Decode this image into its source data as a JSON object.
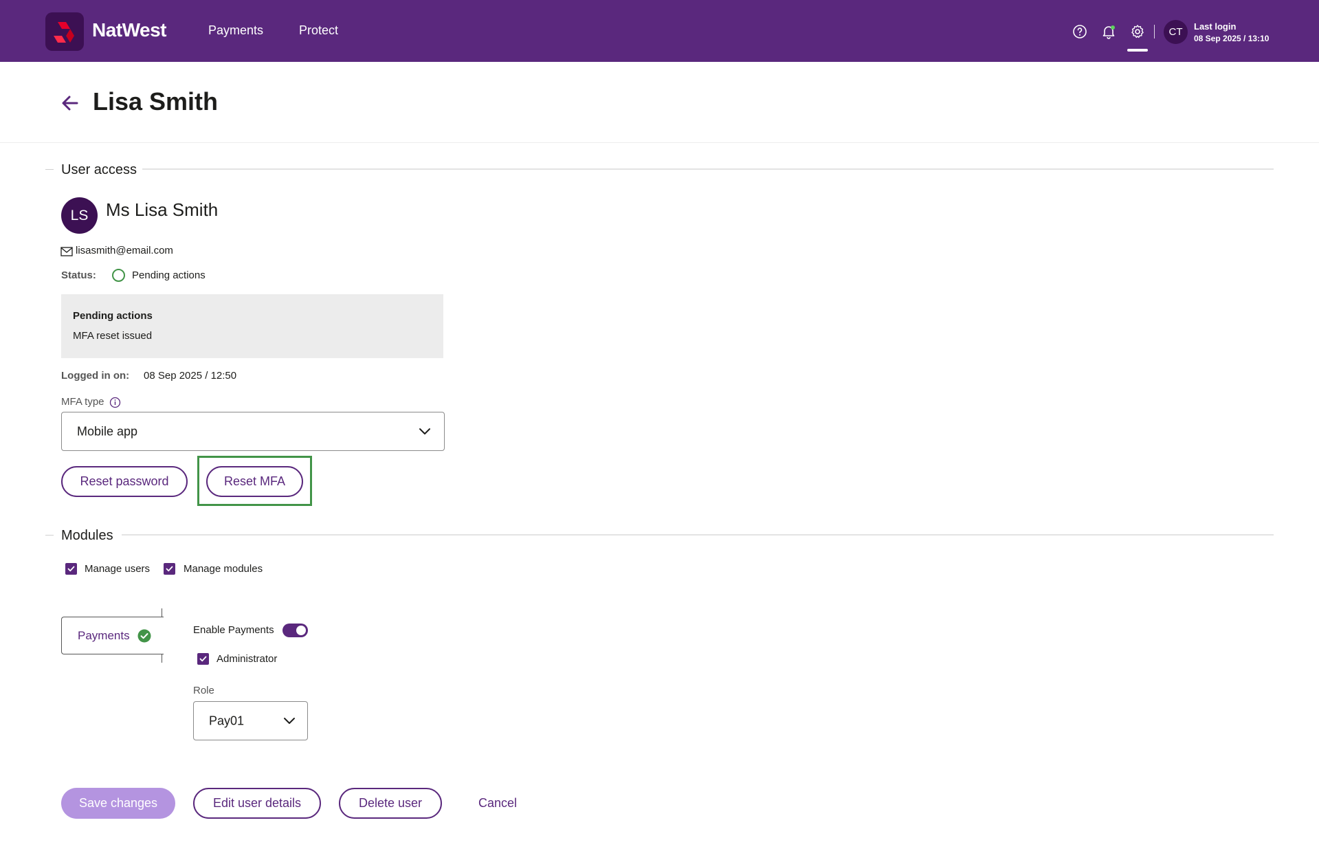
{
  "header": {
    "brand": "NatWest",
    "nav": [
      "Payments",
      "Protect"
    ],
    "icons": [
      "help-icon",
      "bell-icon",
      "gear-icon"
    ],
    "avatar_initials": "CT",
    "last_login_label": "Last login",
    "last_login_value": "08 Sep 2025 / 13:10"
  },
  "page": {
    "title": "Lisa Smith"
  },
  "user_access": {
    "section_title": "User access",
    "avatar_initials": "LS",
    "name": "Ms Lisa Smith",
    "email": "lisasmith@email.com",
    "status_label": "Status:",
    "status_value": "Pending actions",
    "pending_title": "Pending actions",
    "pending_item": "MFA reset issued",
    "logged_in_label": "Logged in on:",
    "logged_in_value": "08 Sep 2025 / 12:50",
    "mfa_label": "MFA type",
    "mfa_value": "Mobile app",
    "reset_password": "Reset password",
    "reset_mfa": "Reset MFA"
  },
  "modules": {
    "section_title": "Modules",
    "manage_users": "Manage users",
    "manage_modules": "Manage modules",
    "tab_label": "Payments",
    "enable_label": "Enable Payments",
    "enable_on": true,
    "administrator": "Administrator",
    "role_label": "Role",
    "role_value": "Pay01"
  },
  "actions": {
    "save": "Save changes",
    "edit": "Edit user details",
    "delete": "Delete user",
    "cancel": "Cancel"
  },
  "colors": {
    "brand_purple": "#5a287d",
    "dark_purple": "#3c1053",
    "success_green": "#429448",
    "disabled_purple": "#b494e0"
  }
}
